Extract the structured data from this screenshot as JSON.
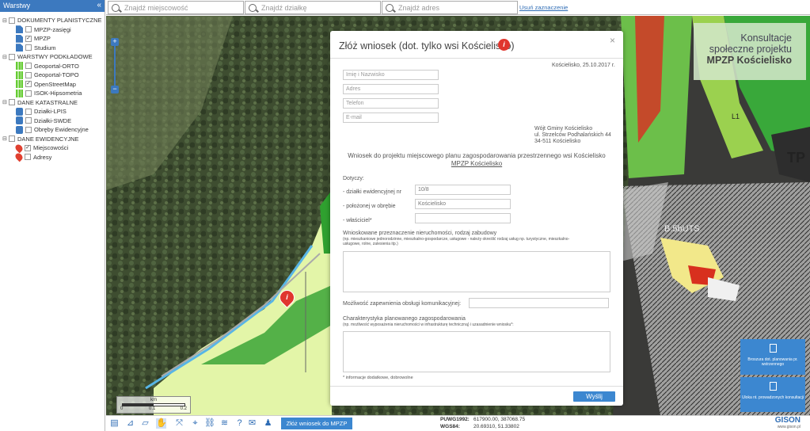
{
  "sidebar": {
    "title": "Warstwy",
    "groups": [
      {
        "label": "DOKUMENTY PLANISTYCZNE",
        "items": [
          {
            "label": "MPZP-zasięgi",
            "checked": false
          },
          {
            "label": "MPZP",
            "checked": true
          },
          {
            "label": "Studium",
            "checked": false
          }
        ]
      },
      {
        "label": "WARSTWY PODKŁADOWE",
        "items": [
          {
            "label": "Geoportal-ORTO",
            "checked": false
          },
          {
            "label": "Geoportal-TOPO",
            "checked": false
          },
          {
            "label": "OpenStreetMap",
            "checked": true
          },
          {
            "label": "ISOK-Hipsometria",
            "checked": false
          }
        ]
      },
      {
        "label": "DANE KATASTRALNE",
        "items": [
          {
            "label": "Działki-LPIS",
            "checked": false
          },
          {
            "label": "Działki-SWDE",
            "checked": false
          },
          {
            "label": "Obręby Ewidencyjne",
            "checked": false
          }
        ]
      },
      {
        "label": "DANE EWIDENCYJNE",
        "items": [
          {
            "label": "Miejscowości",
            "checked": true
          },
          {
            "label": "Adresy",
            "checked": false
          }
        ]
      }
    ]
  },
  "search": {
    "place_placeholder": "Znajdź miejscowość",
    "parcel_placeholder": "Znajdź działkę",
    "address_placeholder": "Znajdź adres",
    "clear_label": "Usuń zaznaczenie"
  },
  "consult": {
    "line1": "Konsultacje",
    "line2": "społeczne projektu",
    "line3": "MPZP Kościelisko"
  },
  "side_buttons": [
    {
      "label": "Broszura dot. planowania pr. wstrzennego"
    },
    {
      "label": "Uloka nt. prowadzonych konsultacji"
    }
  ],
  "modal": {
    "title": "Złóż wniosek (dot. tylko wsi Kościelisko)",
    "badge": "i",
    "date": "Kościelisko, 25.10.2017 r.",
    "fields": {
      "name": "Imię i Nazwisko",
      "address": "Adres",
      "phone": "Telefon",
      "email": "E-mail"
    },
    "recipient": [
      "Wójt Gminy Kościelisko",
      "ul. Strzelców Podhalańskich 44",
      "34-511 Kościelisko"
    ],
    "heading": "Wniosek do projektu miejscowego planu zagospodarowania przestrzennego wsi Kościelisko",
    "heading_link": "MPZP Kościelisko",
    "concerns": "Dotyczy:",
    "parcel_label": "- działki ewidencyjnej nr",
    "parcel_value": "10/8",
    "precinct_label": "- położonej w obrębie",
    "precinct_value": "Kościelisko",
    "owner_label": "- właściciel*",
    "purpose_label": "Wnioskowane przeznaczenie nieruchomości, rodzaj zabudowy",
    "purpose_hint": "(np. mieszkaniowe jednorodzinne, mieszkalno-gospodarcze, usługowe - należy określić rodzaj usług np. turystyczne, mieszkalno-usługowe, rolne, zalesienia itp.)",
    "access_label": "Możliwość zapewnienia obsługi komunikacyjnej:",
    "char_label": "Charakterystyka planowanego zagospodarowania",
    "char_hint": "(np. możliwość wyposażenia nieruchomości w infrastrukturę techniczną) i uzasadnienie wniosku*:",
    "footnote": "* informacje dodatkowe, dobrowolne",
    "submit": "Wyślij",
    "close": "×"
  },
  "map": {
    "labels": [
      "TP",
      "B.5bUTS",
      "L1"
    ],
    "pin": "i"
  },
  "scale": {
    "unit": "km",
    "ticks": [
      "0",
      "0.1",
      "0.2"
    ]
  },
  "bottom": {
    "submit_label": "Złóż wniosek do MPZP",
    "puwg_label": "PUWG1992:",
    "puwg_value": "617900.00, 387068.75",
    "wgs_label": "WGS84:",
    "wgs_value": "20.69310, 51.33802",
    "brand": "GISON",
    "brand_url": "www.gison.pl"
  }
}
